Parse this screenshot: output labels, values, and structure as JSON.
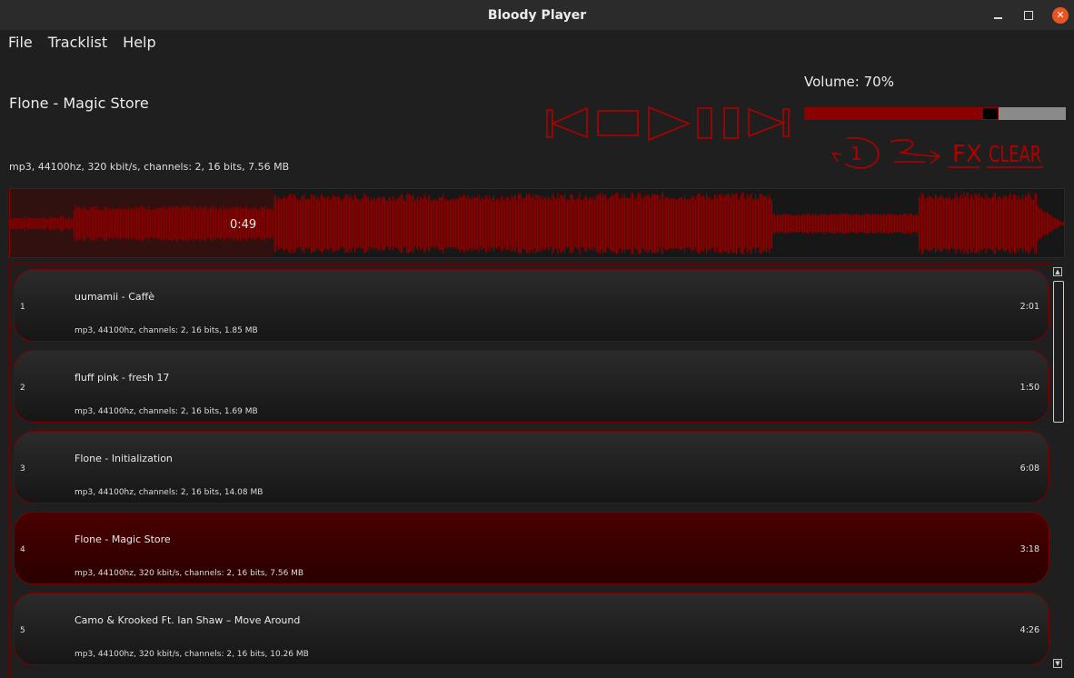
{
  "window": {
    "title": "Bloody Player",
    "controls": [
      "minimize",
      "maximize",
      "close"
    ]
  },
  "menu": [
    {
      "label": "File"
    },
    {
      "label": "Tracklist"
    },
    {
      "label": "Help"
    }
  ],
  "now_playing": {
    "title": "Flone - Magic Store",
    "info": "mp3, 44100hz, 320 kbit/s, channels: 2, 16 bits, 7.56 MB",
    "position_label": "0:49",
    "progress_fraction": 0.25
  },
  "transport": [
    "previous-icon",
    "stop-icon",
    "play-icon",
    "pause-icon",
    "next-icon"
  ],
  "volume": {
    "label": "Volume: 70%",
    "fraction": 0.7
  },
  "tools": {
    "repeat_one": "1",
    "fx_label": "FX",
    "clear_label": "CLEAR"
  },
  "tracks": [
    {
      "num": "1",
      "name": "uumamii - Caffè",
      "info": "mp3, 44100hz, channels: 2, 16 bits, 1.85 MB",
      "duration": "2:01",
      "active": false
    },
    {
      "num": "2",
      "name": "fluff pink - fresh 17",
      "info": "mp3, 44100hz, channels: 2, 16 bits, 1.69 MB",
      "duration": "1:50",
      "active": false
    },
    {
      "num": "3",
      "name": "Flone - Initialization",
      "info": "mp3, 44100hz, channels: 2, 16 bits, 14.08 MB",
      "duration": "6:08",
      "active": false
    },
    {
      "num": "4",
      "name": "Flone - Magic Store",
      "info": "mp3, 44100hz, 320 kbit/s, channels: 2, 16 bits, 7.56 MB",
      "duration": "3:18",
      "active": true
    },
    {
      "num": "5",
      "name": "Camo & Krooked Ft. Ian Shaw – Move Around",
      "info": "mp3, 44100hz, 320 kbit/s, channels: 2, 16 bits, 10.26 MB",
      "duration": "4:26",
      "active": false
    }
  ],
  "colors": {
    "accent": "#8b0000",
    "background": "#1f1f1f",
    "close_button": "#e95420"
  }
}
